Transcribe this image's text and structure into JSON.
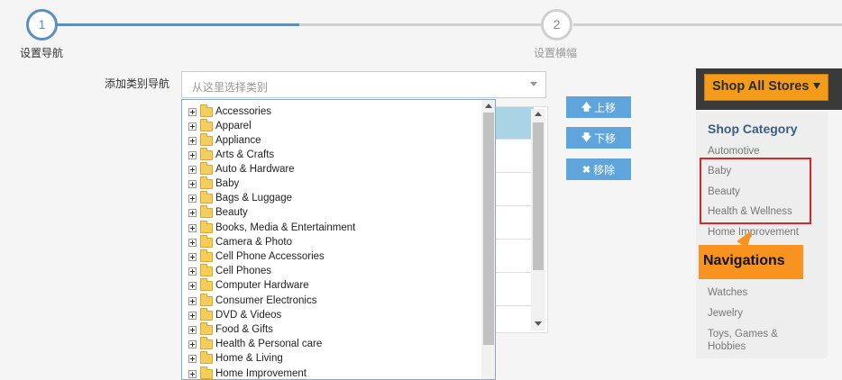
{
  "stepper": {
    "step1": {
      "number": "1",
      "label": "设置导航"
    },
    "step2": {
      "number": "2",
      "label": "设置横幅"
    }
  },
  "form": {
    "field_label": "添加类别导航",
    "select_placeholder": "从这里选择类别"
  },
  "tree_items": [
    "Accessories",
    "Apparel",
    "Appliance",
    "Arts & Crafts",
    "Auto & Hardware",
    "Baby",
    "Bags & Luggage",
    "Beauty",
    "Books, Media & Entertainment",
    "Camera & Photo",
    "Cell Phone Accessories",
    "Cell Phones",
    "Computer Hardware",
    "Consumer Electronics",
    "DVD & Videos",
    "Food & Gifts",
    "Health & Personal care",
    "Home & Living",
    "Home Improvement"
  ],
  "buttons": {
    "up": {
      "label": "上移",
      "icon": "arrow-up-icon"
    },
    "down": {
      "label": "下移",
      "icon": "arrow-down-icon"
    },
    "remove": {
      "label": "移除",
      "icon": "x-icon"
    }
  },
  "store": {
    "button_label": "Shop All Stores",
    "category_title": "Shop Category",
    "categories": [
      "Automotive",
      "Baby",
      "Beauty",
      "Health & Wellness",
      "Home Improvement",
      "Watches",
      "Jewelry",
      "Toys, Games &",
      "Hobbies"
    ],
    "callout": "Navigations"
  },
  "colors": {
    "accent": "#5a8fbf",
    "button": "#5fa5dc",
    "orange": "#f39c1a",
    "highlight_box": "#d9262a"
  }
}
